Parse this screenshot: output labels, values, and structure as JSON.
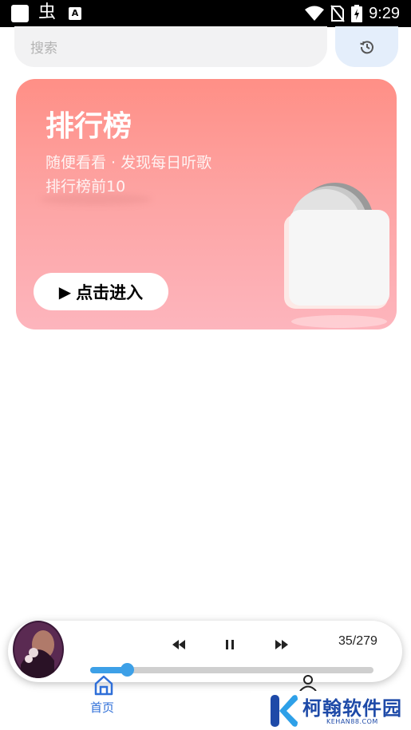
{
  "status_bar": {
    "app_glyph": "虫",
    "time": "9:29"
  },
  "search": {
    "placeholder": "搜索"
  },
  "banner": {
    "title": "排行榜",
    "subtitle": "随便看看 · 发现每日听歌",
    "subtitle2": "排行榜前10",
    "button_label": "点击进入",
    "play_glyph": "▶"
  },
  "player": {
    "track_counter": "35/279",
    "progress_fraction": 0.13
  },
  "nav": {
    "home_label": "首页"
  },
  "watermark": {
    "name": "柯翰软件园",
    "url": "KEHAN88.COM"
  },
  "colors": {
    "accent": "#3da0e7",
    "nav_active": "#2f6fd8",
    "banner_top": "#ff8f86",
    "banner_bottom": "#fdb5bd",
    "watermark": "#1e4aa8"
  }
}
